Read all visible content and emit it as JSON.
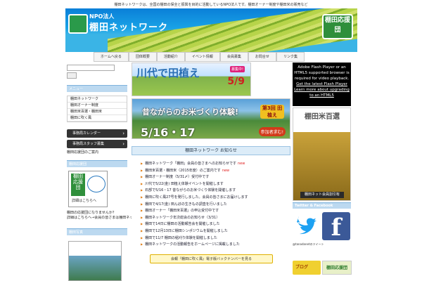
{
  "header": {
    "tagline": "棚田ネットワークは、全国の棚田の保全と振興を目的に活動しているNPO法人です。棚田オーナー制度や棚田米の販売など",
    "npo_label": "NPO法人",
    "org_name": "棚田ネットワーク",
    "badge": "棚田応援団"
  },
  "nav": [
    "ホームへ戻る",
    "団体概要",
    "活動紹介",
    "イベント情報",
    "会員募集",
    "お問合せ",
    "リンク集"
  ],
  "sidebar": {
    "search_placeholder": "",
    "section_title": "メニュー",
    "menu_items": [
      "棚田ネットワーク",
      "棚田オーナー制度",
      "棚田米百選・棚田米",
      "棚田に吹く風"
    ],
    "calendar_btn": "事務局カレンダー",
    "staff_btn": "事務局スタッフ募集",
    "staff_note": "棚田応援団のご案内",
    "ouen_title": "棚田応援団",
    "ouen_text": "棚田の応援団になりませんか？",
    "ouen_text2": "詳細はこちらへ→会員の皆さまは棚田ネットワークへ",
    "ouen_more": "詳細はこちらへ",
    "photo_title": "棚田写真"
  },
  "main": {
    "promo1_title": "川代で田植え",
    "promo1_status": "募集中!",
    "promo1_date": "5/9",
    "promo2_title": "昔ながらのお米づくり体験!",
    "promo2_dates": "5/16・17",
    "promo2_tag": "第3回 田植え",
    "promo2_cta": "参加者求む!",
    "news_title": "棚田ネットワーク お知らせ",
    "news": [
      {
        "text": "棚田ネットワーク「棚田」会員の皆さまへのお知らせです",
        "new": "new"
      },
      {
        "text": "棚田米百選・棚田米（2015年度）のご案内です",
        "new": "new"
      },
      {
        "text": "棚田オーナー制度（5/31〆）受付中です",
        "new": ""
      },
      {
        "text": "川代で5/22(金) 田植え体験イベントを開催します",
        "new": ""
      },
      {
        "text": "石部で5/16・17 昔ながらのお米づくり体験を開催します",
        "new": ""
      },
      {
        "text": "棚田に吹く風27号を発行しました。会員の皆さまにお届けします",
        "new": ""
      },
      {
        "text": "棚田で4/17(金) 田んぼの生きもの調査を行いました",
        "new": ""
      },
      {
        "text": "棚田オーナー「棚田米百選」の申込受付中です",
        "new": ""
      },
      {
        "text": "棚田ネットワーク年次総会のお知らせ（3/31）",
        "new": ""
      },
      {
        "text": "棚田で14日に棚田の活動報告会を開催しました",
        "new": ""
      },
      {
        "text": "棚田で12月13日に棚田シンポジウムを開催しました",
        "new": ""
      },
      {
        "text": "棚田で11/7 棚田の稲刈り体験を開催しました",
        "new": ""
      },
      {
        "text": "棚田ネットワークの活動報告をホームページに掲載しました",
        "new": ""
      }
    ],
    "backnumber_btn": "会報『棚田に吹く風』電子版バックナンバーを見る"
  },
  "right": {
    "flash_text": "Adobe Flash Player or an HTML5 supported browser is required for video playback.",
    "flash_link1": "Get the latest Flash Player",
    "flash_link2": "Learn more about upgrading to an HTML5",
    "rice_title": "棚田米百選",
    "rice_sub": "棚田ネット会員割引有",
    "social_title": "Twitter & Facebook",
    "social_note": "@tanadanetのツイート",
    "blog_label": "ブログ",
    "blog2_label": "棚田応援団"
  }
}
